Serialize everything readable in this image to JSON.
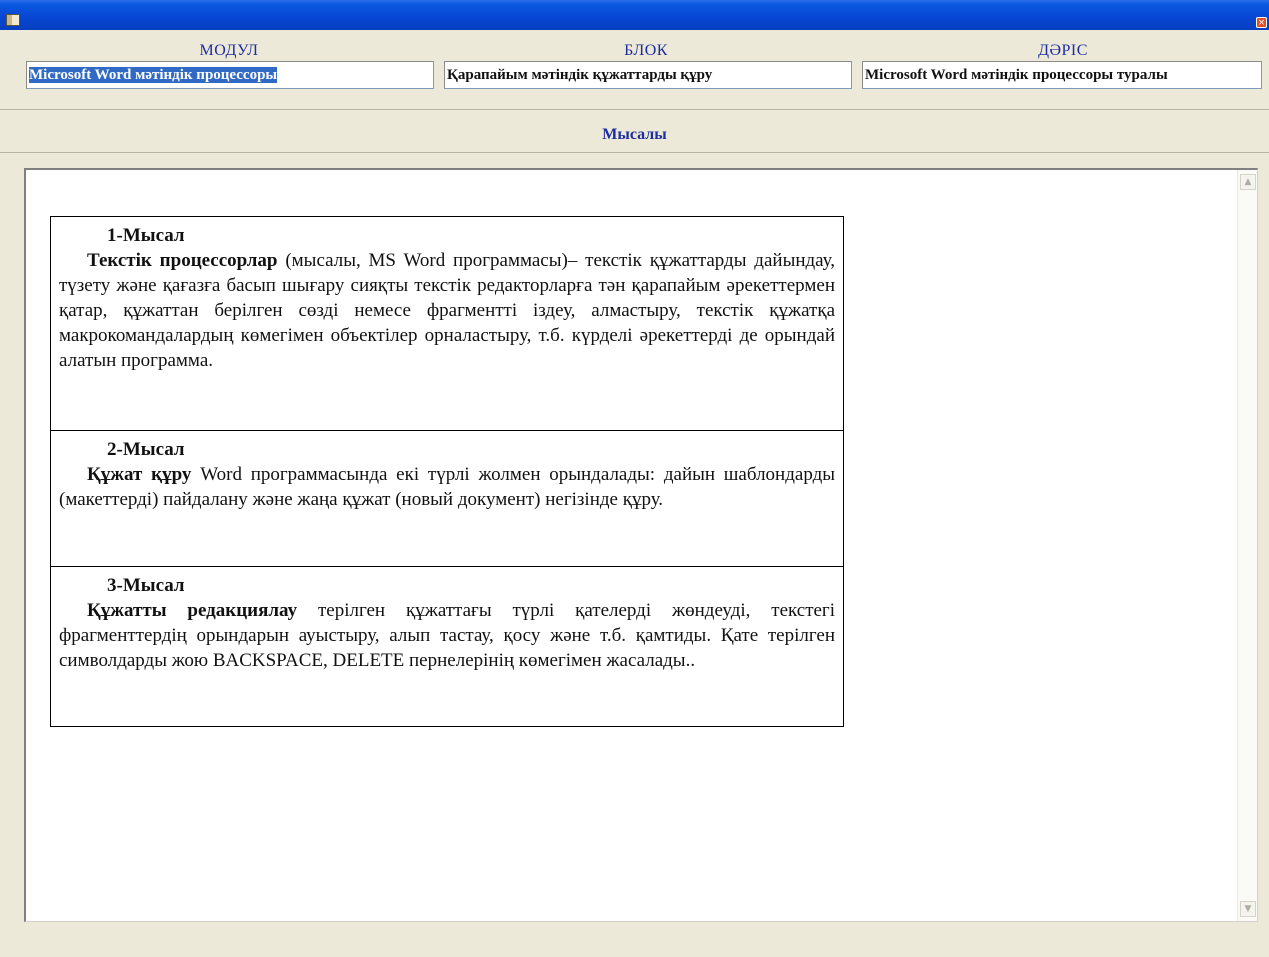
{
  "window": {
    "close_symbol": "×",
    "icon": "application-icon"
  },
  "fields": {
    "module": {
      "label": "МОДУЛ",
      "value": "Microsoft Word мәтіндік процессоры"
    },
    "block": {
      "label": "БЛОК",
      "value": "Қарапайым мәтіндік құжаттарды құру"
    },
    "lecture": {
      "label": "ДӘРІС",
      "value": "Microsoft Word мәтіндік процессоры туралы"
    }
  },
  "section": {
    "title": "Мысалы"
  },
  "examples": [
    {
      "heading": "1-Мысал",
      "term": "Текстік процессорлар",
      "text": " (мысалы, MS Word программасы)– текстік құжаттарды дайындау, түзету және қағазға басып шығару сияқты текстік редакторларға тән қарапайым әрекеттермен қатар, құжаттан берілген сөзді немесе фрагментті іздеу, алмастыру, текстік құжатқа макрокомандалардың көмегімен объектілер орналастыру, т.б. күрделі әрекеттерді де орындай алатын программа."
    },
    {
      "heading": "2-Мысал",
      "term": "Құжат құру",
      "text": " Word программасында екі түрлі жолмен орындалады: дайын шаблондарды (макеттерді) пайдалану және жаңа құжат (новый документ) негізінде құру."
    },
    {
      "heading": "3-Мысал",
      "term": "Құжатты редакциялау",
      "text": " терілген құжаттағы түрлі қателерді жөндеуді, текстегі фрагменттердің орындарын ауыстыру, алып тастау, қосу және т.б. қамтиды. Қате терілген символдарды жою  BACKSPACE, DELETE пернелерінің көмегімен жасалады.."
    }
  ],
  "scrollbar": {
    "up_symbol": "▲",
    "down_symbol": "▼"
  }
}
